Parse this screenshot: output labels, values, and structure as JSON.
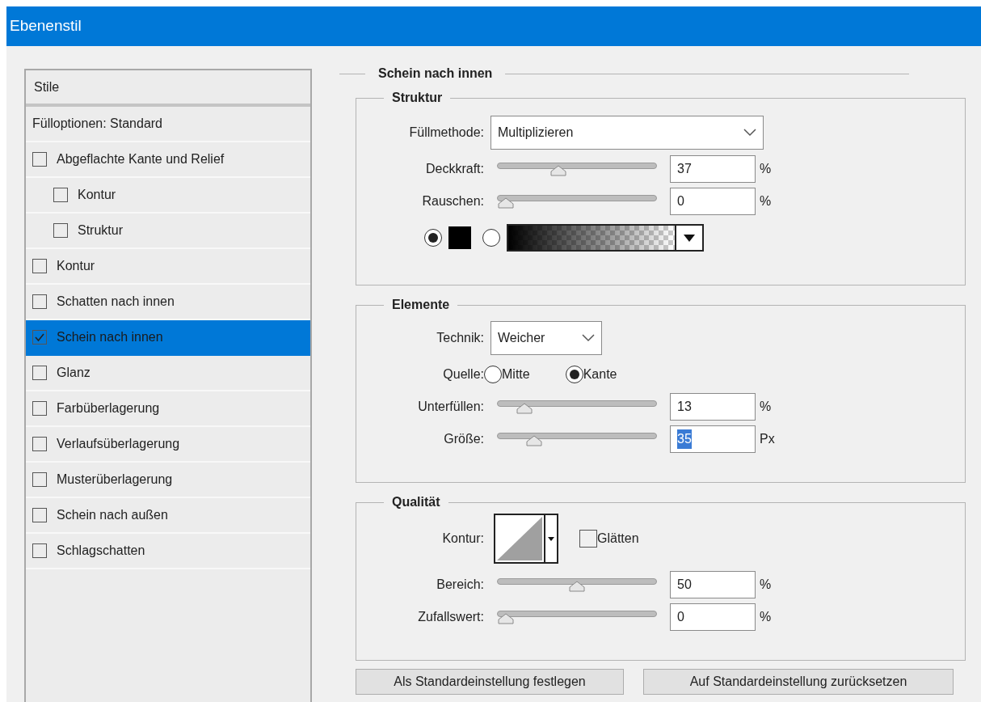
{
  "window": {
    "title": "Ebenenstil"
  },
  "styles_list": {
    "header": "Stile",
    "items": [
      {
        "kind": "option",
        "label": "Fülloptionen: Standard",
        "selected": false
      },
      {
        "kind": "checkbox",
        "label": "Abgeflachte Kante und Relief",
        "checked": false,
        "selected": false,
        "children": [
          {
            "kind": "checkbox",
            "label": "Kontur",
            "checked": false,
            "selected": false
          },
          {
            "kind": "checkbox",
            "label": "Struktur",
            "checked": false,
            "selected": false
          }
        ]
      },
      {
        "kind": "checkbox",
        "label": "Kontur",
        "checked": false,
        "selected": false
      },
      {
        "kind": "checkbox",
        "label": "Schatten nach innen",
        "checked": false,
        "selected": false
      },
      {
        "kind": "checkbox",
        "label": "Schein nach innen",
        "checked": true,
        "selected": true
      },
      {
        "kind": "checkbox",
        "label": "Glanz",
        "checked": false,
        "selected": false
      },
      {
        "kind": "checkbox",
        "label": "Farbüberlagerung",
        "checked": false,
        "selected": false
      },
      {
        "kind": "checkbox",
        "label": "Verlaufsüberlagerung",
        "checked": false,
        "selected": false
      },
      {
        "kind": "checkbox",
        "label": "Musterüberlagerung",
        "checked": false,
        "selected": false
      },
      {
        "kind": "checkbox",
        "label": "Schein nach außen",
        "checked": false,
        "selected": false
      },
      {
        "kind": "checkbox",
        "label": "Schlagschatten",
        "checked": false,
        "selected": false
      }
    ]
  },
  "panel": {
    "title": "Schein nach innen",
    "structure": {
      "title": "Struktur",
      "blend_mode": {
        "label": "Füllmethode:",
        "value": "Multiplizieren"
      },
      "sliders": [
        {
          "label": "Deckkraft:",
          "level": 0.37,
          "value": "37",
          "unit": "%"
        },
        {
          "label": "Rauschen:",
          "level": 0,
          "value": "0",
          "unit": "%"
        }
      ],
      "fill_options": [
        {
          "kind": "color",
          "selected": true,
          "color": "#000000"
        },
        {
          "kind": "gradient",
          "selected": false
        }
      ]
    },
    "elements": {
      "title": "Elemente",
      "technique": {
        "label": "Technik:",
        "value": "Weicher"
      },
      "source": {
        "label": "Quelle:",
        "options": [
          {
            "label": "Mitte",
            "selected": false
          },
          {
            "label": "Kante",
            "selected": true
          }
        ]
      },
      "sliders": [
        {
          "label": "Unterfüllen:",
          "level": 0.13,
          "value": "13",
          "unit": "%"
        },
        {
          "label": "Größe:",
          "level": 0.2,
          "value": "35",
          "unit": "Px",
          "text_selected": true
        }
      ]
    },
    "quality": {
      "title": "Qualität",
      "contour": {
        "label": "Kontur:"
      },
      "smooth": {
        "label": "Glätten",
        "checked": false
      },
      "sliders": [
        {
          "label": "Bereich:",
          "level": 0.5,
          "value": "50",
          "unit": "%"
        },
        {
          "label": "Zufallswert:",
          "level": 0,
          "value": "0",
          "unit": "%"
        }
      ]
    }
  },
  "buttons": [
    "Als Standardeinstellung festlegen",
    "Auf Standardeinstellung zurücksetzen"
  ]
}
